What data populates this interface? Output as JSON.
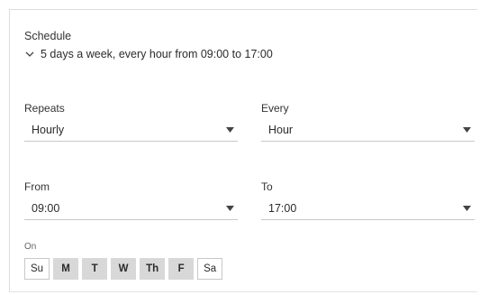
{
  "schedule": {
    "title": "Schedule",
    "summary": "5 days a week, every hour from 09:00 to 17:00",
    "summary_icon": "chevron-down-icon"
  },
  "repeats": {
    "label": "Repeats",
    "value": "Hourly"
  },
  "every": {
    "label": "Every",
    "value": "Hour"
  },
  "from": {
    "label": "From",
    "value": "09:00"
  },
  "to": {
    "label": "To",
    "value": "17:00"
  },
  "days": {
    "label": "On",
    "items": [
      {
        "label": "Su",
        "selected": false
      },
      {
        "label": "M",
        "selected": true
      },
      {
        "label": "T",
        "selected": true
      },
      {
        "label": "W",
        "selected": true
      },
      {
        "label": "Th",
        "selected": true
      },
      {
        "label": "F",
        "selected": true
      },
      {
        "label": "Sa",
        "selected": false
      }
    ]
  },
  "colors": {
    "selected_day_bg": "#d8d8d8",
    "border": "#c8c8c8"
  }
}
